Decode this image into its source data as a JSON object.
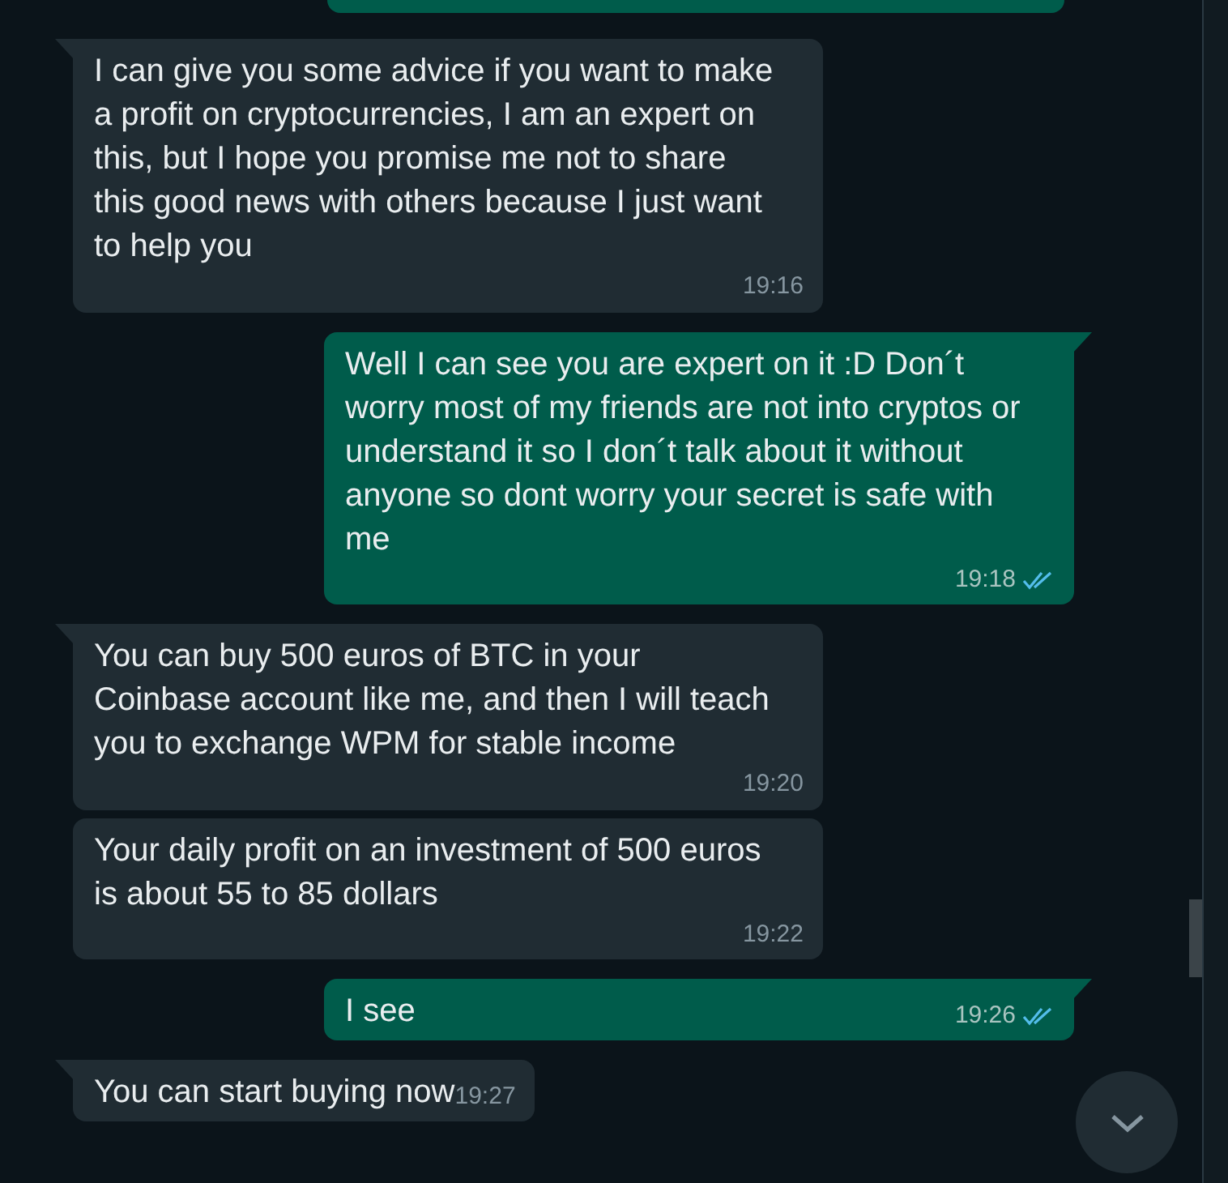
{
  "messages": [
    {
      "kind": "incoming",
      "tail": true,
      "text": "I can give you some advice if you want to make a profit on cryptocurrencies, I am an expert on this, but I hope you promise me not to share this good news with others because I just want to help you",
      "time": "19:16"
    },
    {
      "kind": "outgoing",
      "tail": true,
      "read": true,
      "text": "Well I can see you are expert on it :D Don´t worry most of my friends are not into cryptos or understand it so I don´t talk about it without anyone so dont worry your secret is safe with me",
      "time": "19:18"
    },
    {
      "kind": "incoming",
      "tail": true,
      "text": "You can buy 500 euros of BTC in your Coinbase account like me, and then I will teach you to exchange WPM for stable income",
      "time": "19:20"
    },
    {
      "kind": "incoming",
      "tail": false,
      "text": "Your daily profit on an investment of 500 euros is about 55 to 85 dollars",
      "time": "19:22"
    },
    {
      "kind": "outgoing",
      "tail": true,
      "read": true,
      "text": "I see",
      "time": "19:26"
    },
    {
      "kind": "incoming",
      "tail": true,
      "text": "You can start buying now",
      "time": "19:27"
    }
  ]
}
